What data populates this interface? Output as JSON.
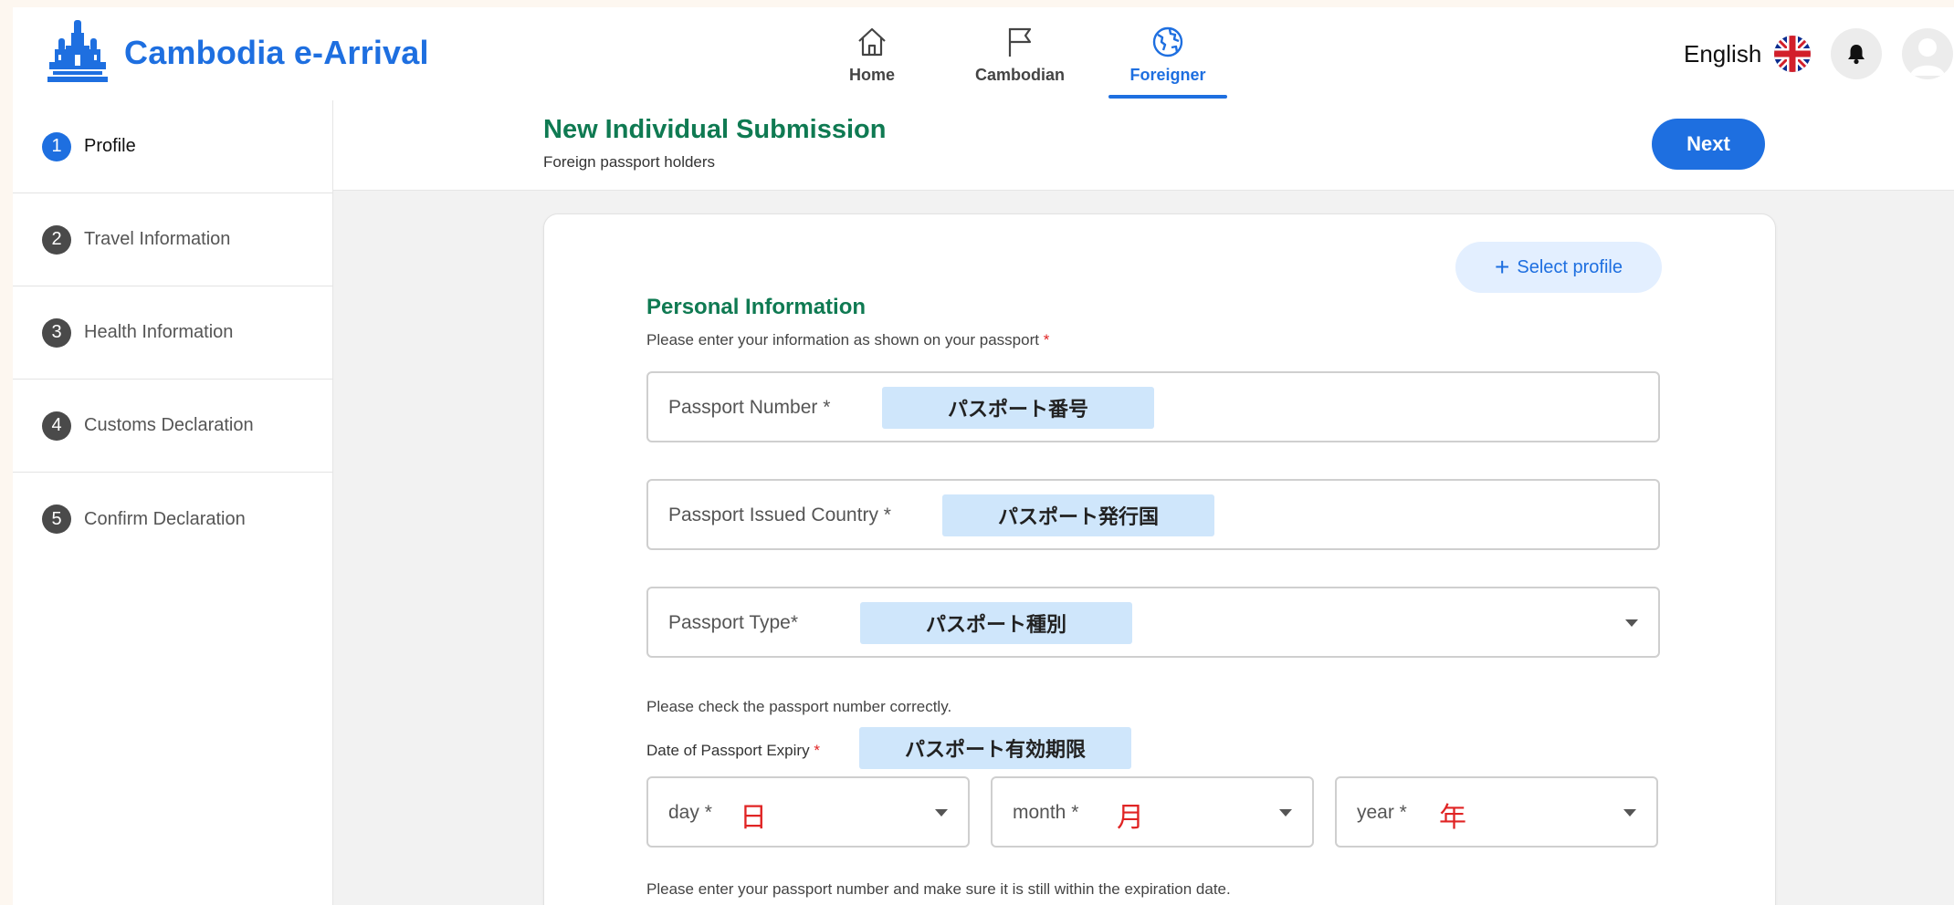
{
  "header": {
    "brand_title": "Cambodia e-Arrival",
    "nav": [
      {
        "label": "Home",
        "icon": "home-icon",
        "active": false
      },
      {
        "label": "Cambodian",
        "icon": "flag-icon",
        "active": false
      },
      {
        "label": "Foreigner",
        "icon": "globe-icon",
        "active": true
      }
    ],
    "language": "English"
  },
  "sidebar": {
    "steps": [
      {
        "number": "1",
        "label": "Profile",
        "active": true
      },
      {
        "number": "2",
        "label": "Travel Information",
        "active": false
      },
      {
        "number": "3",
        "label": "Health Information",
        "active": false
      },
      {
        "number": "4",
        "label": "Customs Declaration",
        "active": false
      },
      {
        "number": "5",
        "label": "Confirm Declaration",
        "active": false
      }
    ]
  },
  "subheader": {
    "title": "New Individual Submission",
    "caption": "Foreign passport holders",
    "next_label": "Next"
  },
  "form": {
    "select_profile_label": "Select profile",
    "section_title": "Personal Information",
    "section_note": "Please enter your information as shown on your passport",
    "required_mark": "*",
    "fields": {
      "passport_number": {
        "label": "Passport Number *",
        "annotation": "パスポート番号"
      },
      "issued_country": {
        "label": "Passport Issued Country *",
        "annotation": "パスポート発行国"
      },
      "passport_type": {
        "label": "Passport Type*",
        "annotation": "パスポート種別"
      }
    },
    "check_hint": "Please check the passport number correctly.",
    "expiry": {
      "label": "Date of Passport Expiry",
      "annotation": "パスポート有効期限",
      "day": {
        "label": "day *",
        "annotation": "日"
      },
      "month": {
        "label": "month *",
        "annotation": "月"
      },
      "year": {
        "label": "year *",
        "annotation": "年"
      }
    },
    "bottom_hint": "Please enter your passport number and make sure it is still within the expiration date."
  },
  "colors": {
    "brand_blue": "#1e6fe0",
    "heading_green": "#0f7a52",
    "required_red": "#e02424",
    "annotation_bg": "#cfe6fb"
  }
}
